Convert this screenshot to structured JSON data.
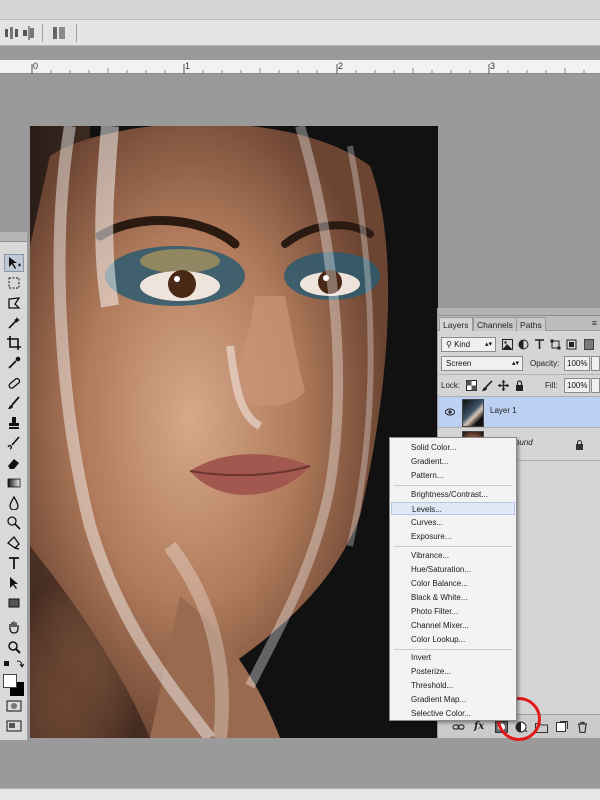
{
  "ruler": {
    "marks": [
      "0",
      "1",
      "2",
      "3"
    ]
  },
  "tools": [
    {
      "name": "move-tool",
      "icon": "move-icon"
    },
    {
      "name": "marquee-tool",
      "icon": "marquee-icon"
    },
    {
      "name": "lasso-tool",
      "icon": "lasso-icon"
    },
    {
      "name": "quick-select-tool",
      "icon": "magic-wand-icon"
    },
    {
      "name": "crop-tool",
      "icon": "crop-icon"
    },
    {
      "name": "eyedropper-tool",
      "icon": "eyedropper-icon"
    },
    {
      "name": "healing-brush-tool",
      "icon": "bandage-icon"
    },
    {
      "name": "brush-tool",
      "icon": "brush-icon"
    },
    {
      "name": "clone-stamp-tool",
      "icon": "stamp-icon"
    },
    {
      "name": "history-brush-tool",
      "icon": "history-brush-icon"
    },
    {
      "name": "eraser-tool",
      "icon": "eraser-icon"
    },
    {
      "name": "gradient-tool",
      "icon": "gradient-icon"
    },
    {
      "name": "blur-tool",
      "icon": "drop-icon"
    },
    {
      "name": "dodge-tool",
      "icon": "dodge-icon"
    },
    {
      "name": "pen-tool",
      "icon": "pen-icon"
    },
    {
      "name": "type-tool",
      "icon": "type-icon"
    },
    {
      "name": "path-select-tool",
      "icon": "arrow-icon"
    },
    {
      "name": "shape-tool",
      "icon": "rectangle-icon"
    },
    {
      "name": "hand-tool",
      "icon": "hand-icon"
    },
    {
      "name": "zoom-tool",
      "icon": "zoom-icon"
    }
  ],
  "layers_panel": {
    "tabs": [
      "Layers",
      "Channels",
      "Paths"
    ],
    "filter": "Kind",
    "blend_mode": "Screen",
    "opacity_label": "Opacity:",
    "opacity_value": "100%",
    "lock_label": "Lock:",
    "fill_label": "Fill:",
    "fill_value": "100%",
    "layers": [
      {
        "name": "Layer 1",
        "selected": true
      },
      {
        "name": "Background",
        "selected": false,
        "locked": true
      }
    ]
  },
  "adjust_menu": {
    "groups": [
      [
        "Solid Color...",
        "Gradient...",
        "Pattern..."
      ],
      [
        "Brightness/Contrast...",
        "Levels...",
        "Curves...",
        "Exposure..."
      ],
      [
        "Vibrance...",
        "Hue/Saturation...",
        "Color Balance...",
        "Black & White...",
        "Photo Filter...",
        "Channel Mixer...",
        "Color Lookup..."
      ],
      [
        "Invert",
        "Posterize...",
        "Threshold...",
        "Gradient Map...",
        "Selective Color..."
      ]
    ],
    "hovered": "Levels..."
  },
  "colors": {
    "highlight_circle": "#e01a1a",
    "selected_layer": "#bcd0f1"
  }
}
